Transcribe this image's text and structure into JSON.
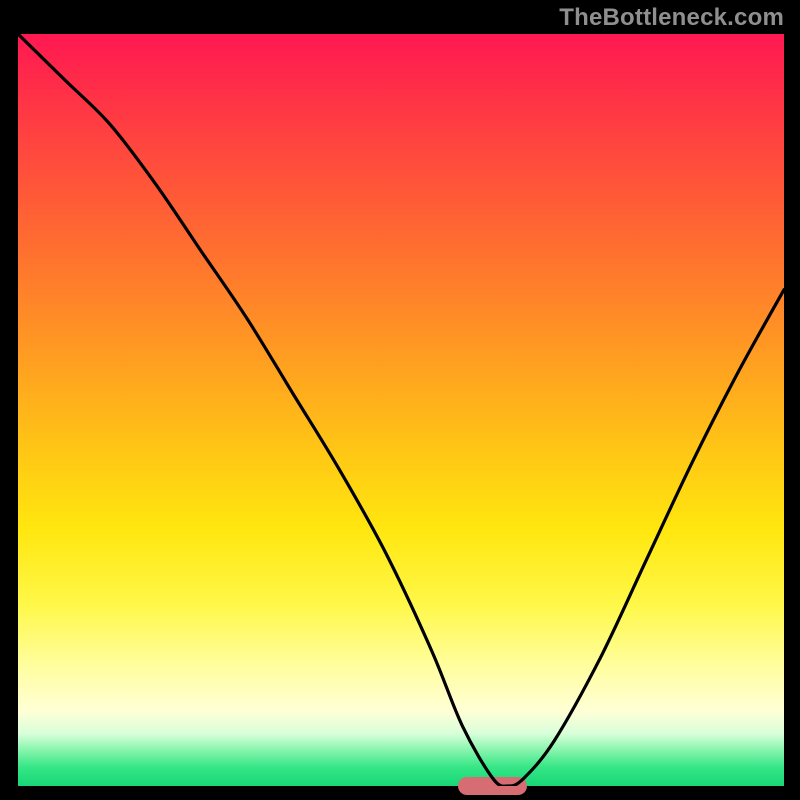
{
  "watermark": "TheBottleneck.com",
  "chart_data": {
    "type": "line",
    "title": "",
    "xlabel": "",
    "ylabel": "",
    "xlim": [
      0,
      100
    ],
    "ylim": [
      0,
      100
    ],
    "grid": false,
    "series": [
      {
        "name": "bottleneck-curve",
        "x": [
          0,
          6,
          12,
          18,
          24,
          30,
          36,
          42,
          48,
          54,
          58,
          62,
          64,
          66,
          70,
          76,
          82,
          88,
          94,
          100
        ],
        "y": [
          100,
          94,
          88,
          80,
          71,
          62,
          52,
          42,
          31,
          18,
          8,
          1,
          0,
          1,
          6,
          17,
          30,
          43,
          55,
          66
        ]
      }
    ],
    "marker": {
      "x": 62,
      "y": 0,
      "width_pct": 9
    },
    "background_gradient": {
      "orientation": "vertical",
      "stops": [
        {
          "pos": 0.0,
          "color": "#ff1852"
        },
        {
          "pos": 0.27,
          "color": "#ff6a31"
        },
        {
          "pos": 0.55,
          "color": "#ffc515"
        },
        {
          "pos": 0.76,
          "color": "#fff84a"
        },
        {
          "pos": 0.9,
          "color": "#ffffd6"
        },
        {
          "pos": 0.95,
          "color": "#8ff6b1"
        },
        {
          "pos": 1.0,
          "color": "#17d777"
        }
      ]
    },
    "colors": {
      "curve": "#000000",
      "marker": "#d56d73",
      "frame": "#000000"
    }
  }
}
